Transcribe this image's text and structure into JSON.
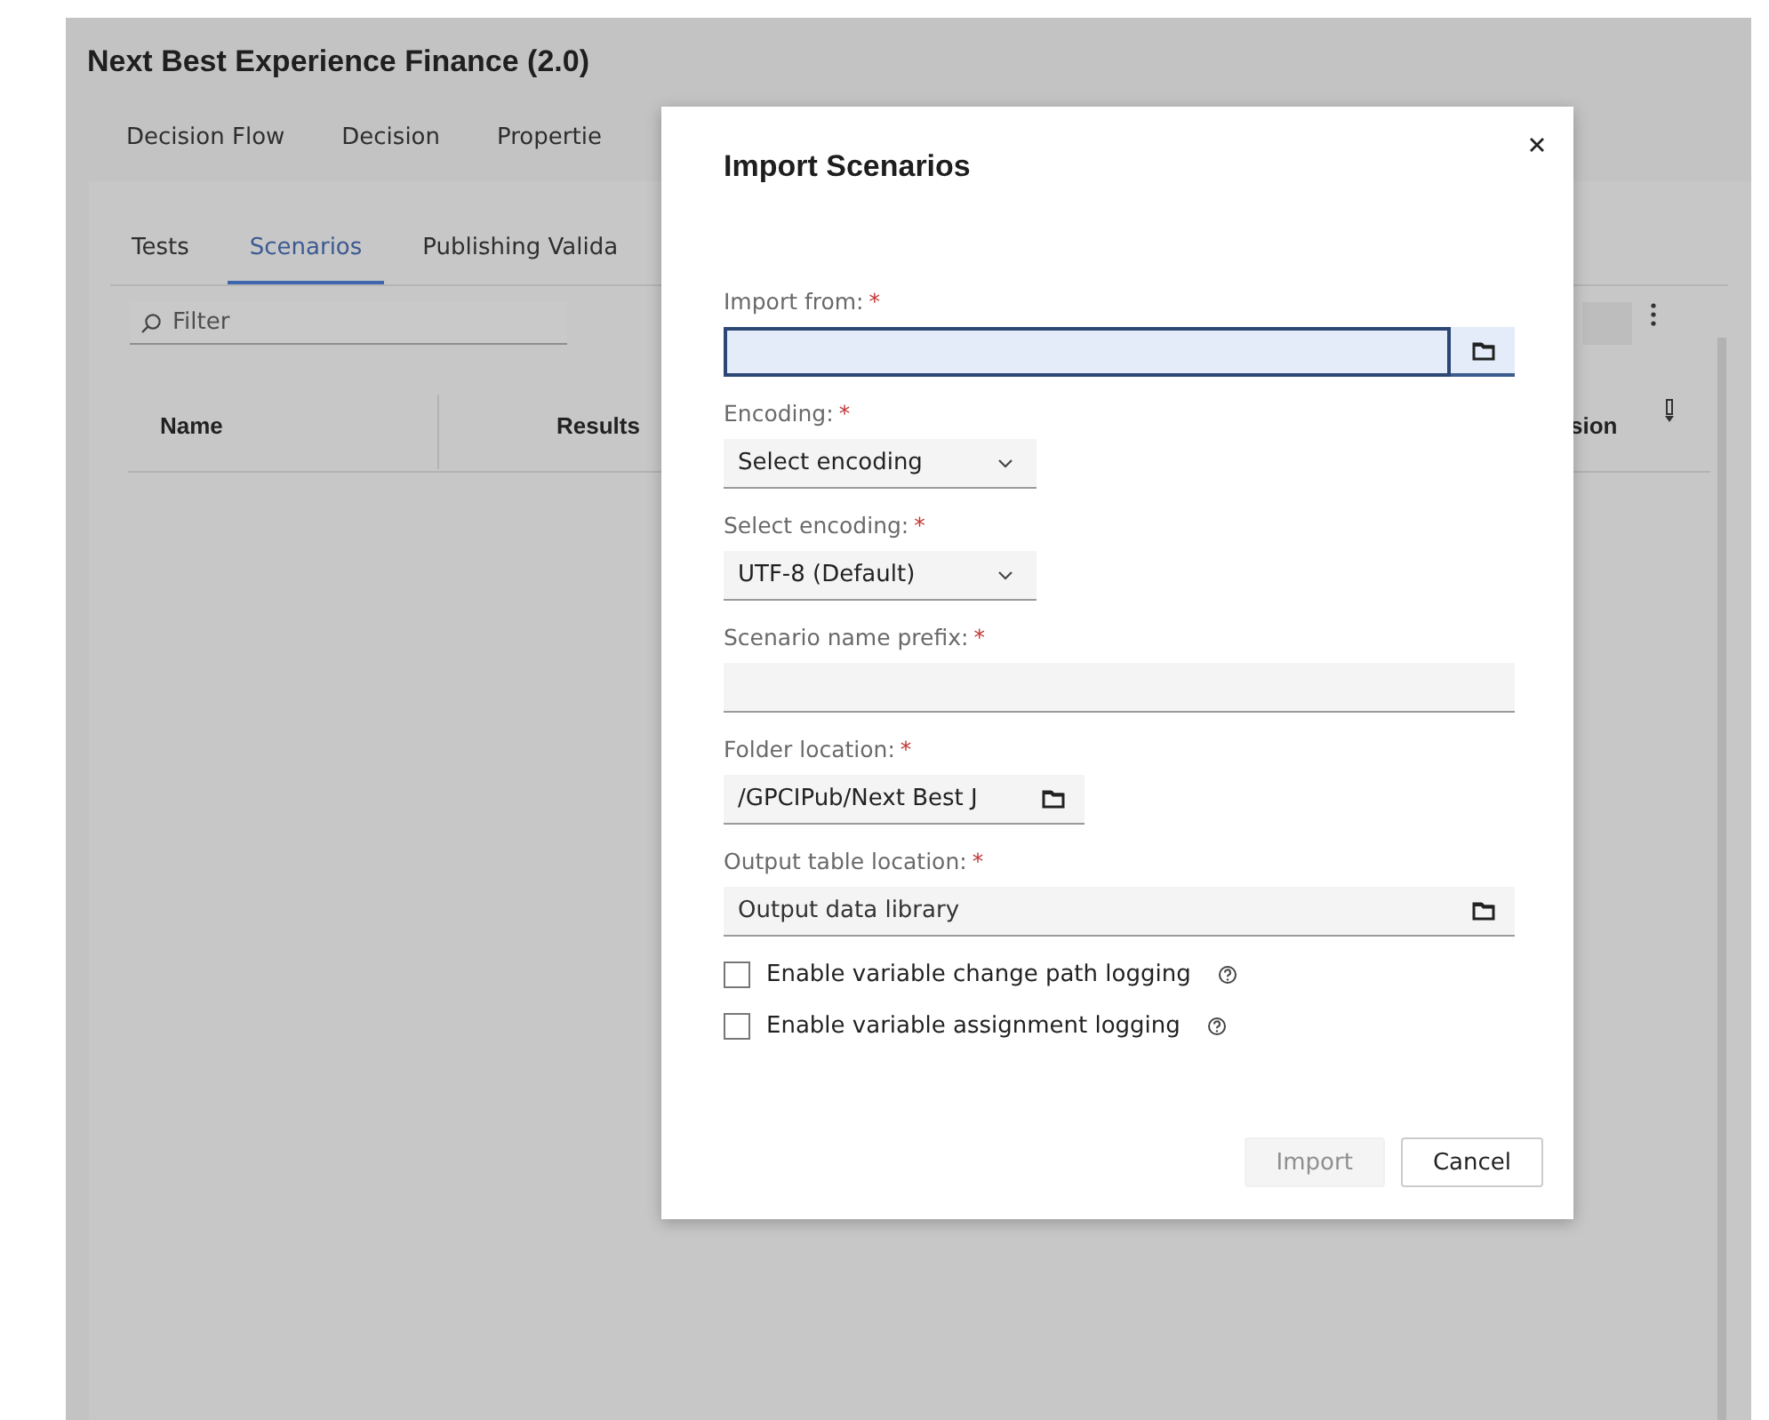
{
  "app": {
    "title": "Next Best Experience Finance (2.0)",
    "tabs": [
      {
        "label": "Decision Flow",
        "selected": false
      },
      {
        "label": "Decision",
        "selected": false
      },
      {
        "label": "Propertie",
        "selected": false
      }
    ],
    "subtabs": [
      {
        "label": "Tests",
        "selected": false
      },
      {
        "label": "Scenarios",
        "selected": true
      },
      {
        "label": "Publishing Valida",
        "selected": false
      }
    ],
    "filter": {
      "placeholder": "Filter"
    },
    "table": {
      "columns": [
        "Name",
        "Results",
        "sion"
      ]
    }
  },
  "dialog": {
    "title": "Import Scenarios",
    "fields": [
      {
        "kind": "path",
        "label": "Import from:",
        "mark": "*",
        "focused": true
      },
      {
        "kind": "select",
        "label": "Encoding:",
        "mark": "*",
        "value": "Select encoding",
        "focused": false
      },
      {
        "kind": "select",
        "label": "Select encoding:",
        "mark": "*",
        "value": "UTF-8 (Default)",
        "focused": false
      },
      {
        "kind": "text",
        "label": "Scenario name prefix:",
        "mark": "*",
        "focused": false
      },
      {
        "kind": "short-path",
        "label": "Folder location:",
        "mark": "*",
        "value": "/GPCIPub/Next Best J",
        "focused": false
      },
      {
        "kind": "path",
        "label": "Output table location:",
        "mark": "*",
        "placeholder": "Output data library",
        "focused": false
      }
    ],
    "checkboxes": [
      {
        "label": "Enable variable change path logging",
        "checked": false
      },
      {
        "label": "Enable variable assignment logging",
        "checked": false
      }
    ],
    "buttons": [
      {
        "label": "Import",
        "disabled": true
      },
      {
        "label": "Cancel",
        "disabled": false
      }
    ]
  }
}
